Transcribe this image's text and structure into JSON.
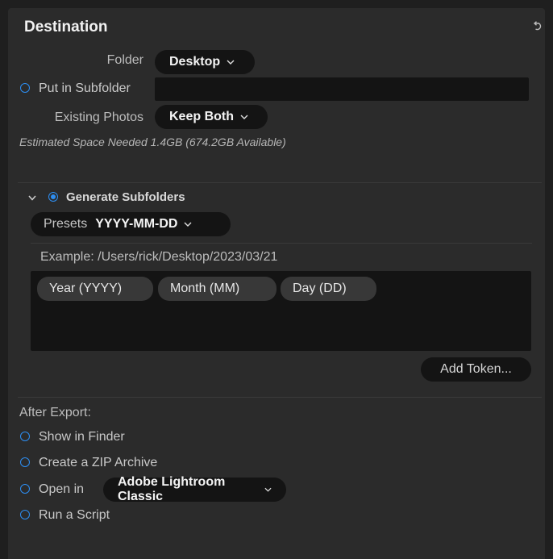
{
  "header": {
    "title": "Destination"
  },
  "destination": {
    "folder_label": "Folder",
    "folder_value": "Desktop",
    "subfolder_label": "Put in Subfolder",
    "subfolder_value": "",
    "existing_label": "Existing Photos",
    "existing_value": "Keep Both",
    "space_text": "Estimated Space Needed 1.4GB (674.2GB Available)"
  },
  "subfolders": {
    "section_label": "Generate Subfolders",
    "presets_label": "Presets",
    "presets_value": "YYYY-MM-DD",
    "example_text": "Example: /Users/rick/Desktop/2023/03/21",
    "tokens": [
      "Year (YYYY)",
      "Month (MM)",
      "Day (DD)"
    ],
    "add_token_label": "Add Token..."
  },
  "after_export": {
    "heading": "After Export:",
    "show_in_finder": "Show in Finder",
    "zip_archive": "Create a ZIP Archive",
    "open_in_label": "Open in",
    "open_in_app": "Adobe Lightroom Classic",
    "run_script": "Run a Script"
  },
  "colors": {
    "accent": "#2d8ef2",
    "panel": "#2b2b2b",
    "field": "#141414"
  }
}
